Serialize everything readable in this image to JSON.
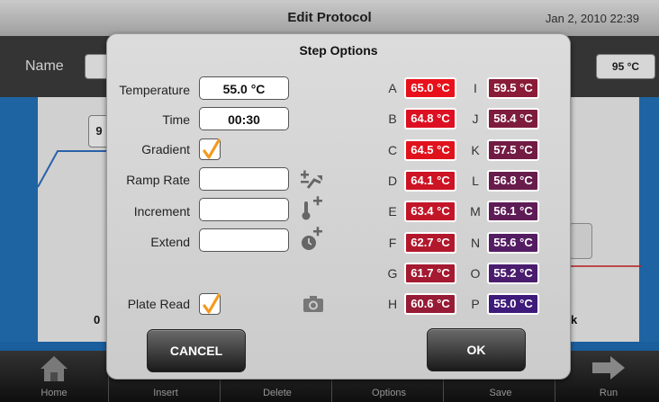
{
  "titlebar": {
    "title": "Edit Protocol",
    "datetime": "Jan 2, 2010 22:39"
  },
  "namebar": {
    "name_label": "Name",
    "lid_temp": "95 °C"
  },
  "graph": {
    "step_value": "9",
    "left_label": "0",
    "right_label": "k"
  },
  "tabs": [
    {
      "label": "Home",
      "icon": "home-icon"
    },
    {
      "label": "Insert",
      "icon": "insert-icon"
    },
    {
      "label": "Delete",
      "icon": "delete-icon"
    },
    {
      "label": "Options",
      "icon": "options-icon"
    },
    {
      "label": "Save",
      "icon": "save-icon"
    },
    {
      "label": "Run",
      "icon": "run-arrow-icon"
    }
  ],
  "dialog": {
    "title": "Step Options",
    "temperature": {
      "label": "Temperature",
      "value": "55.0 °C"
    },
    "time": {
      "label": "Time",
      "value": "00:30"
    },
    "gradient": {
      "label": "Gradient",
      "checked": true
    },
    "ramp_rate": {
      "label": "Ramp Rate",
      "value": "",
      "icon": "ramp-rate-icon"
    },
    "increment": {
      "label": "Increment",
      "value": "",
      "icon": "thermometer-plus-icon"
    },
    "extend": {
      "label": "Extend",
      "value": "",
      "icon": "clock-plus-icon"
    },
    "plate_read": {
      "label": "Plate Read",
      "checked": true,
      "icon": "camera-icon"
    },
    "cancel_label": "CANCEL",
    "ok_label": "OK"
  },
  "gradient_wells": [
    {
      "letter": "A",
      "temp": "65.0 °C",
      "color": "#e8101a"
    },
    {
      "letter": "B",
      "temp": "64.8 °C",
      "color": "#dc1022"
    },
    {
      "letter": "C",
      "temp": "64.5 °C",
      "color": "#e0131d"
    },
    {
      "letter": "D",
      "temp": "64.1 °C",
      "color": "#cc1424"
    },
    {
      "letter": "E",
      "temp": "63.4 °C",
      "color": "#c21628"
    },
    {
      "letter": "F",
      "temp": "62.7 °C",
      "color": "#b2182c"
    },
    {
      "letter": "G",
      "temp": "61.7 °C",
      "color": "#a41a30"
    },
    {
      "letter": "H",
      "temp": "60.6 °C",
      "color": "#961c36"
    },
    {
      "letter": "I",
      "temp": "59.5 °C",
      "color": "#8a1c38"
    },
    {
      "letter": "J",
      "temp": "58.4 °C",
      "color": "#7e1c3e"
    },
    {
      "letter": "K",
      "temp": "57.5 °C",
      "color": "#721c44"
    },
    {
      "letter": "L",
      "temp": "56.8 °C",
      "color": "#681c4c"
    },
    {
      "letter": "M",
      "temp": "56.1 °C",
      "color": "#5e1c56"
    },
    {
      "letter": "N",
      "temp": "55.6 °C",
      "color": "#541c62"
    },
    {
      "letter": "O",
      "temp": "55.2 °C",
      "color": "#4a1c6e"
    },
    {
      "letter": "P",
      "temp": "55.0 °C",
      "color": "#3e1a7a"
    }
  ]
}
